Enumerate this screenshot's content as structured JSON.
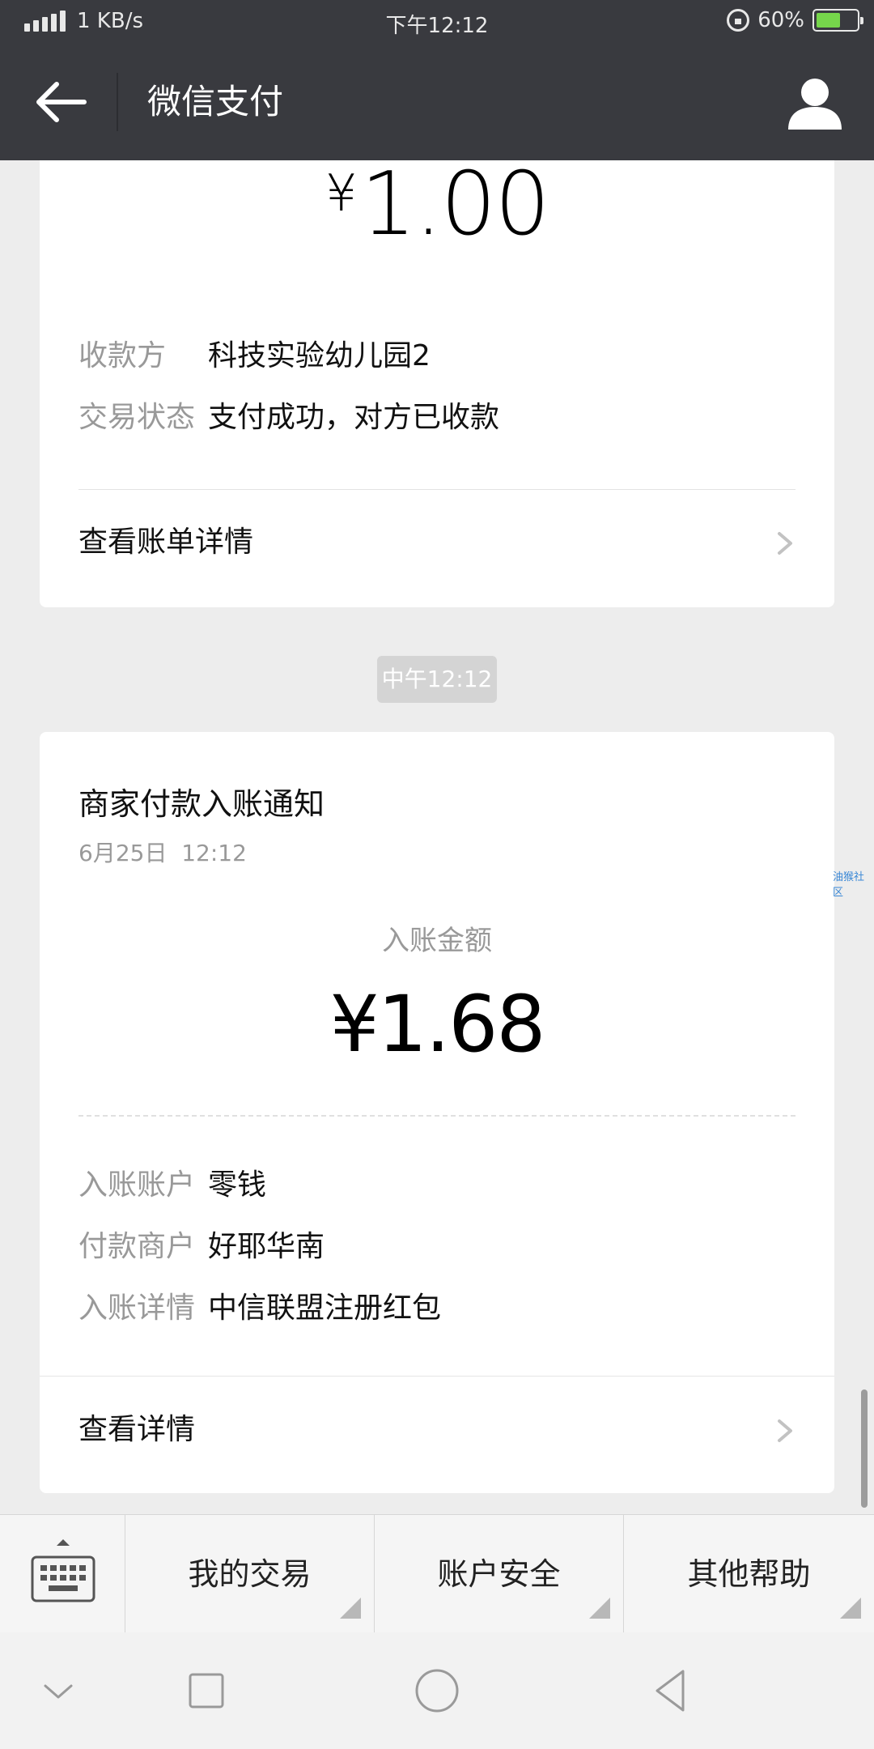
{
  "status_bar": {
    "net_speed": "1 KB/s",
    "time": "下午12:12",
    "battery": "60%",
    "battery_level": 0.6,
    "icons": [
      "signal-icon",
      "rotation-lock-icon",
      "battery-icon"
    ]
  },
  "header": {
    "title": "微信支付",
    "icons": [
      "back-arrow-icon",
      "person-icon"
    ]
  },
  "card1": {
    "currency": "¥",
    "amount": "1.00",
    "rows": [
      {
        "label": "收款方",
        "value": "科技实验幼儿园2"
      },
      {
        "label": "交易状态",
        "value": "支付成功，对方已收款"
      }
    ],
    "link": "查看账单详情"
  },
  "time_chip": "中午12:12",
  "card2": {
    "title": "商家付款入账通知",
    "date": "6月25日  12:12",
    "amount_label": "入账金额",
    "amount": "¥1.68",
    "rows": [
      {
        "label": "入账账户",
        "value": "零钱"
      },
      {
        "label": "付款商户",
        "value": "好耶华南"
      },
      {
        "label": "入账详情",
        "value": "中信联盟注册红包"
      }
    ],
    "link": "查看详情"
  },
  "side_text": "油猴社区",
  "menu": {
    "items": [
      "我的交易",
      "账户安全",
      "其他帮助"
    ],
    "icons": [
      "keyboard-icon"
    ]
  },
  "navbar": {
    "icons": [
      "nav-down-icon",
      "recents-square-icon",
      "home-circle-icon",
      "back-triangle-icon"
    ]
  },
  "colors": {
    "header_bg": "#393a3f",
    "page_bg": "#ededed",
    "card_bg": "#ffffff",
    "label_gray": "#999999"
  }
}
